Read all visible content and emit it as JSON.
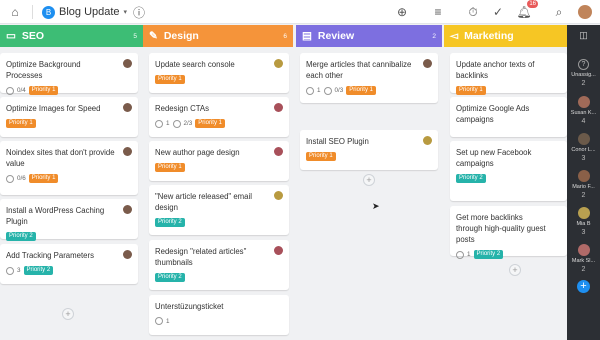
{
  "topbar": {
    "project_name": "Blog Update",
    "project_initial": "B",
    "notifications_count": "16"
  },
  "columns": [
    {
      "title": "SEO",
      "count": "5",
      "color": "#3dbd75",
      "cards": [
        {
          "title": "Optimize Background Processes",
          "meta_count": "0/4",
          "priority": "Priority 1",
          "pclass": "p1"
        },
        {
          "title": "Optimize Images for Speed",
          "meta_count": "",
          "priority": "Priority 1",
          "pclass": "p1"
        },
        {
          "title": "Noindex sites that don't provide value",
          "meta_count": "0/6",
          "priority": "Priority 1",
          "pclass": "p1"
        },
        {
          "title": "Install a WordPress Caching Plugin",
          "meta_count": "",
          "priority": "Priority 2",
          "pclass": "p2"
        },
        {
          "title": "Add Tracking Parameters",
          "meta_count": "3",
          "priority": "Priority 2",
          "pclass": "p2"
        }
      ]
    },
    {
      "title": "Design",
      "count": "6",
      "color": "#f5943a",
      "cards": [
        {
          "title": "Update search console",
          "meta_count": "",
          "priority": "Priority 1",
          "pclass": "p1"
        },
        {
          "title": "Redesign CTAs",
          "meta_count": "1",
          "meta_count2": "2/3",
          "priority": "Priority 1",
          "pclass": "p1"
        },
        {
          "title": "New author page design",
          "meta_count": "",
          "priority": "Priority 1",
          "pclass": "p1"
        },
        {
          "title": "\"New article released\" email design",
          "meta_count": "",
          "priority": "Priority 2",
          "pclass": "p2"
        },
        {
          "title": "Redesign \"related articles\" thumbnails",
          "meta_count": "",
          "priority": "Priority 2",
          "pclass": "p2"
        },
        {
          "title": "Unterstüzungsticket",
          "meta_count": "1",
          "priority": "",
          "pclass": ""
        }
      ]
    },
    {
      "title": "Review",
      "count": "2",
      "color": "#7d6fe0",
      "cards": [
        {
          "title": "Merge articles that cannibalize each other",
          "meta_count": "1",
          "meta_count2": "0/3",
          "priority": "Priority 1",
          "pclass": "p1"
        },
        {
          "title": "Install SEO Plugin",
          "meta_count": "",
          "priority": "Priority 1",
          "pclass": "p1"
        }
      ]
    },
    {
      "title": "Marketing",
      "count": "",
      "color": "#f6c624",
      "cards": [
        {
          "title": "Update anchor texts of backlinks",
          "meta_count": "",
          "priority": "Priority 1",
          "pclass": "p1"
        },
        {
          "title": "Optimize Google Ads campaigns",
          "meta_count": "",
          "priority": "",
          "pclass": ""
        },
        {
          "title": "Set up new Facebook campaigns",
          "meta_count": "",
          "priority": "Priority 2",
          "pclass": "p2"
        },
        {
          "title": "Get more backlinks through high-quality guest posts",
          "meta_count": "1",
          "priority": "Priority 2",
          "pclass": "p2"
        }
      ]
    }
  ],
  "members": [
    {
      "name": "Unassig...",
      "count": "2"
    },
    {
      "name": "Susan K...",
      "count": "4"
    },
    {
      "name": "Conor L...",
      "count": "3"
    },
    {
      "name": "Mario F...",
      "count": "2"
    },
    {
      "name": "Mia B",
      "count": "3"
    },
    {
      "name": "Mark Sl...",
      "count": "2"
    }
  ]
}
